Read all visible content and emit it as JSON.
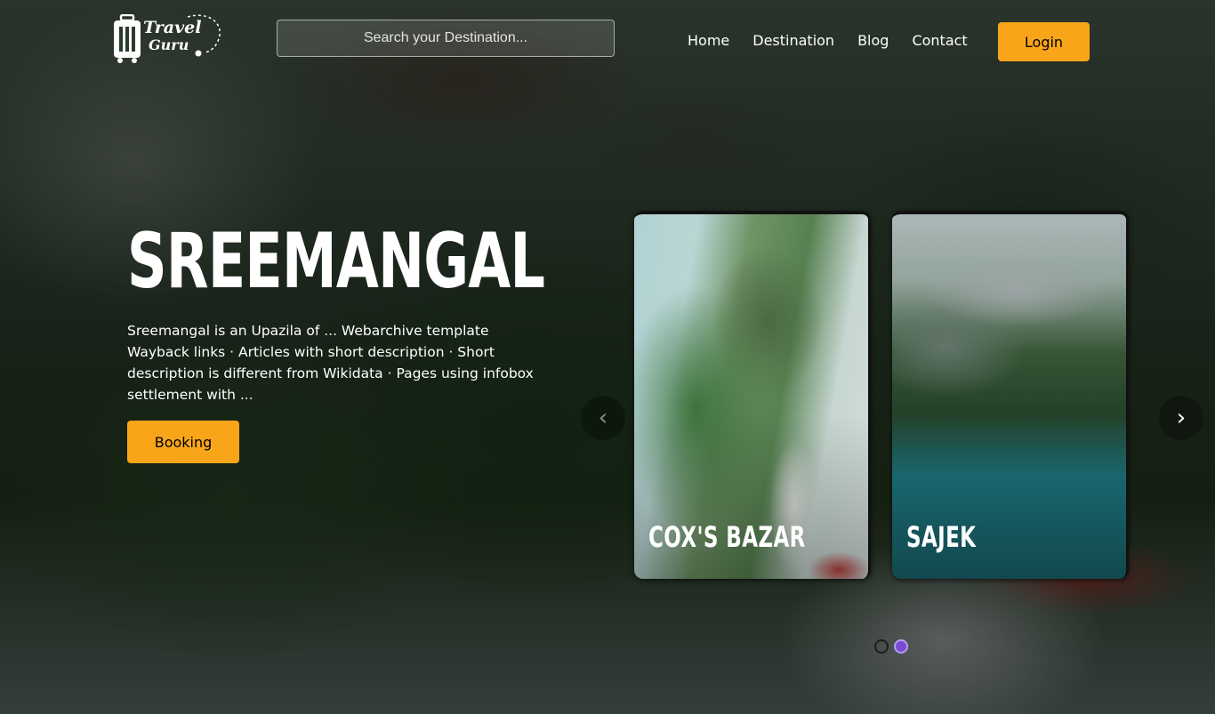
{
  "header": {
    "logo": {
      "line1": "Travel",
      "line2": "Guru"
    },
    "search": {
      "placeholder": "Search your Destination..."
    },
    "nav": [
      {
        "label": "Home"
      },
      {
        "label": "Destination"
      },
      {
        "label": "Blog"
      },
      {
        "label": "Contact"
      }
    ],
    "login_label": "Login"
  },
  "hero": {
    "title": "Sreemangal",
    "description": "Sreemangal is an Upazila of ... Webarchive template Wayback links · Articles with short description · Short description is different from Wikidata · Pages using infobox settlement with ...",
    "booking_label": "Booking"
  },
  "carousel": {
    "prev_icon": "‹",
    "next_icon": "›",
    "cards": [
      {
        "title": "Cox's Bazar"
      },
      {
        "title": "Sajek"
      }
    ],
    "active_dot": 1
  },
  "colors": {
    "accent": "#f9a51a",
    "dot_active": "#7a4bd0"
  }
}
